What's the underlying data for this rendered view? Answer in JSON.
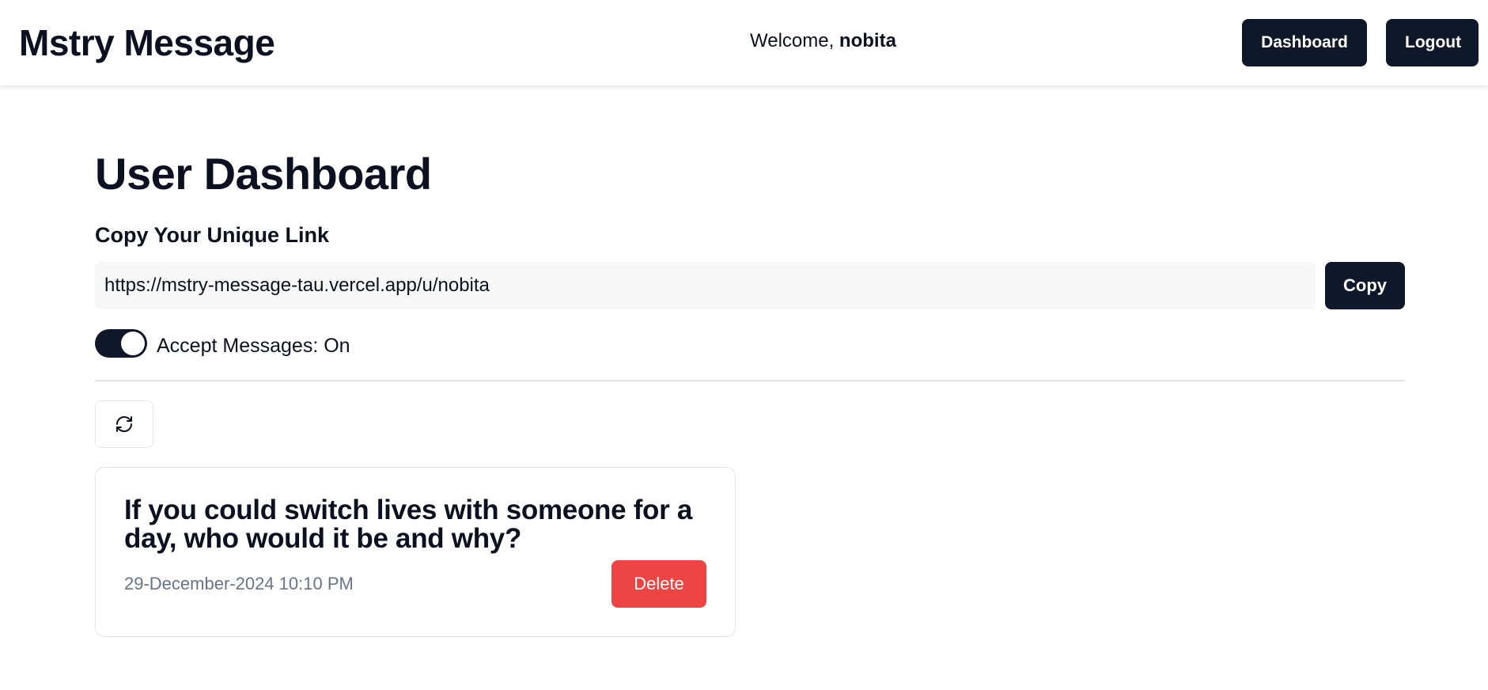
{
  "navbar": {
    "brand": "Mstry Message",
    "welcome_prefix": "Welcome, ",
    "username": "nobita",
    "dashboard_label": "Dashboard",
    "logout_label": "Logout"
  },
  "main": {
    "title": "User Dashboard",
    "link_section_label": "Copy Your Unique Link",
    "unique_link": "https://mstry-message-tau.vercel.app/u/nobita",
    "copy_label": "Copy",
    "accept_messages_label": "Accept Messages: On",
    "accept_messages_on": true,
    "refresh_icon": "refresh-icon"
  },
  "messages": [
    {
      "content": "If you could switch lives with someone for a day, who would it be and why?",
      "date": "29-December-2024 10:10 PM",
      "delete_label": "Delete"
    }
  ],
  "colors": {
    "primary": "#0f172a",
    "danger": "#ef4444",
    "muted_text": "#64748b",
    "border": "#e3e6ea"
  }
}
